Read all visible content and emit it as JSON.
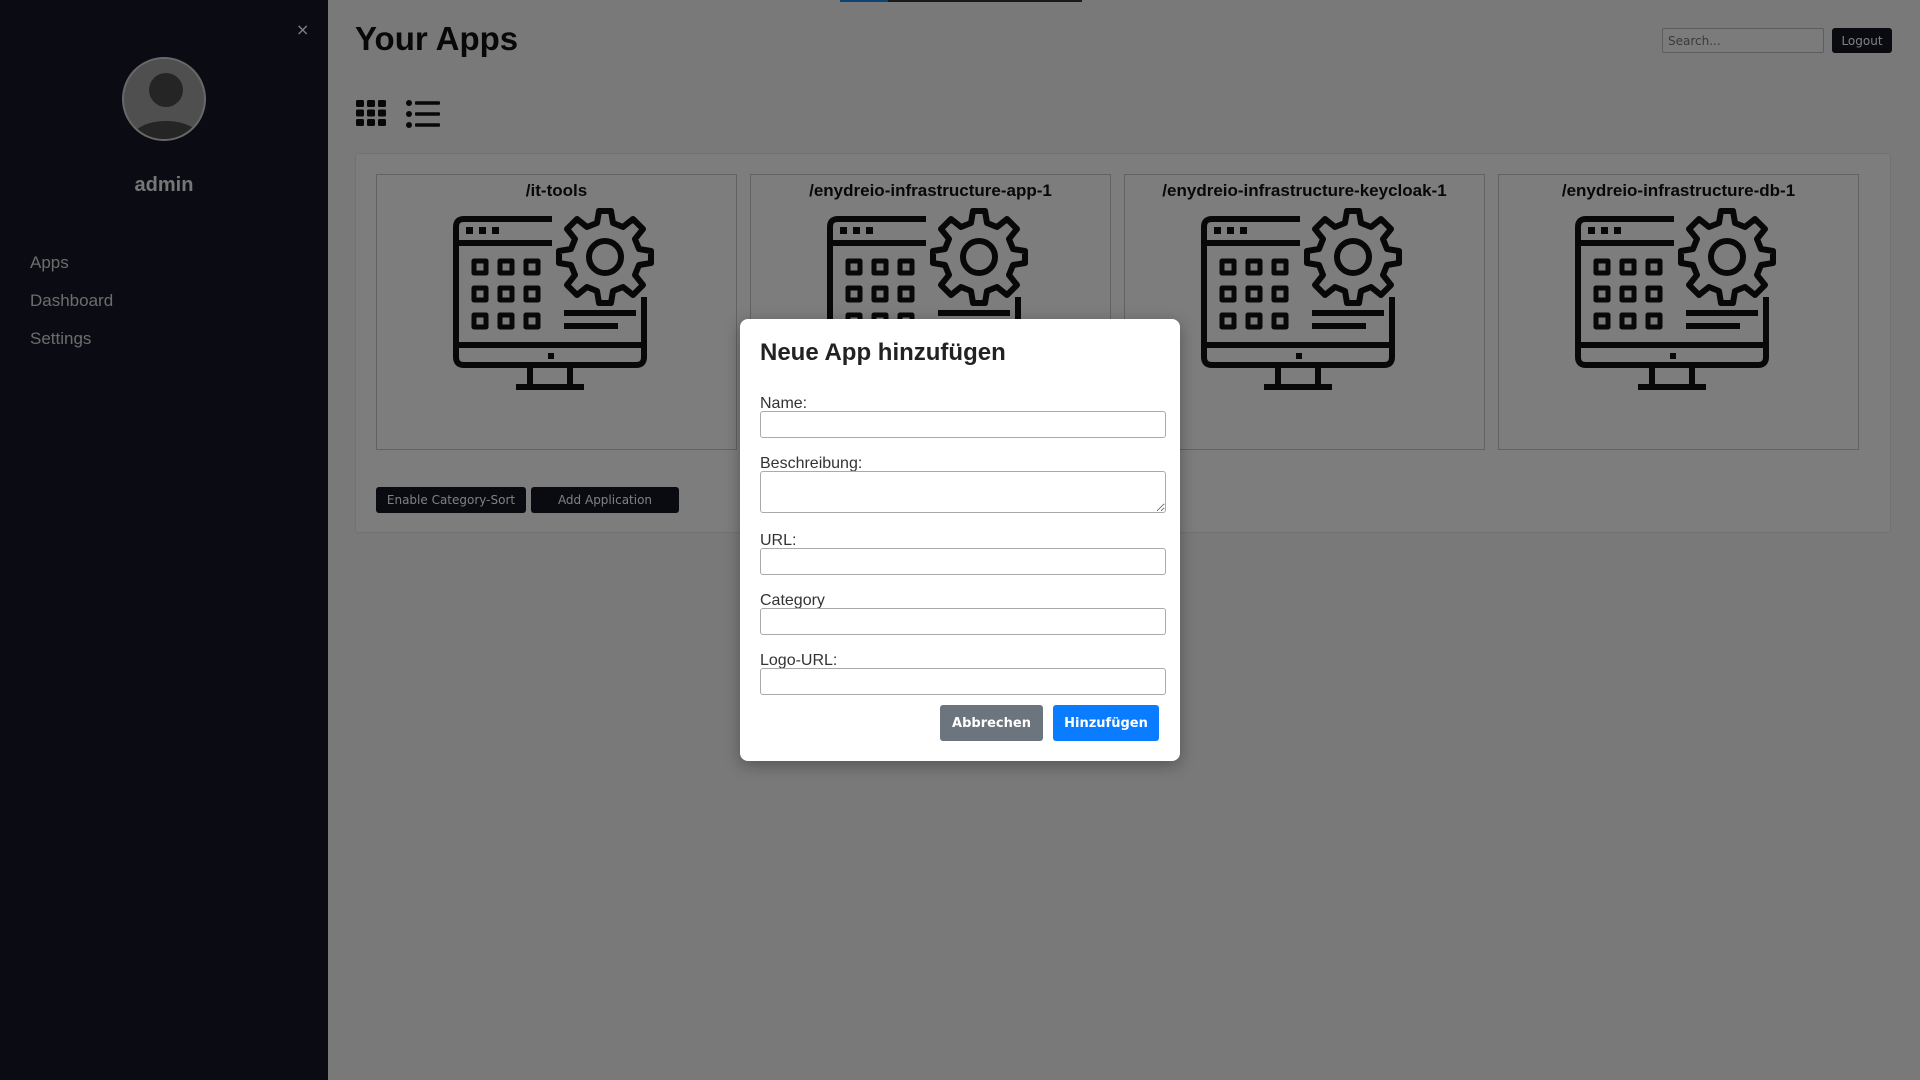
{
  "sidebar": {
    "close_label": "×",
    "username": "admin",
    "nav": [
      {
        "label": "Apps"
      },
      {
        "label": "Dashboard"
      },
      {
        "label": "Settings"
      }
    ]
  },
  "header": {
    "title": "Your Apps",
    "search_placeholder": "Search...",
    "logout_label": "Logout"
  },
  "view_modes": {
    "grid_icon": "grid-view-icon",
    "list_icon": "list-view-icon"
  },
  "apps": [
    {
      "name": "/it-tools",
      "icon": "app-settings-monitor-icon"
    },
    {
      "name": "/enydreio-infrastructure-app-1",
      "icon": "app-settings-monitor-icon"
    },
    {
      "name": "/enydreio-infrastructure-keycloak-1",
      "icon": "app-settings-monitor-icon"
    },
    {
      "name": "/enydreio-infrastructure-db-1",
      "icon": "app-settings-monitor-icon"
    }
  ],
  "actions": {
    "category_sort_label": "Enable Category-Sort",
    "add_application_label": "Add Application"
  },
  "modal": {
    "title": "Neue App hinzufügen",
    "fields": {
      "name_label": "Name:",
      "name_value": "",
      "description_label": "Beschreibung:",
      "description_value": "",
      "url_label": "URL:",
      "url_value": "",
      "category_label": "Category",
      "category_value": "",
      "logo_url_label": "Logo-URL:",
      "logo_url_value": ""
    },
    "cancel_label": "Abbrechen",
    "submit_label": "Hinzufügen"
  },
  "colors": {
    "sidebar_bg": "#161927",
    "dark_button": "#131722",
    "primary": "#0a7cff",
    "secondary": "#6c757d"
  }
}
